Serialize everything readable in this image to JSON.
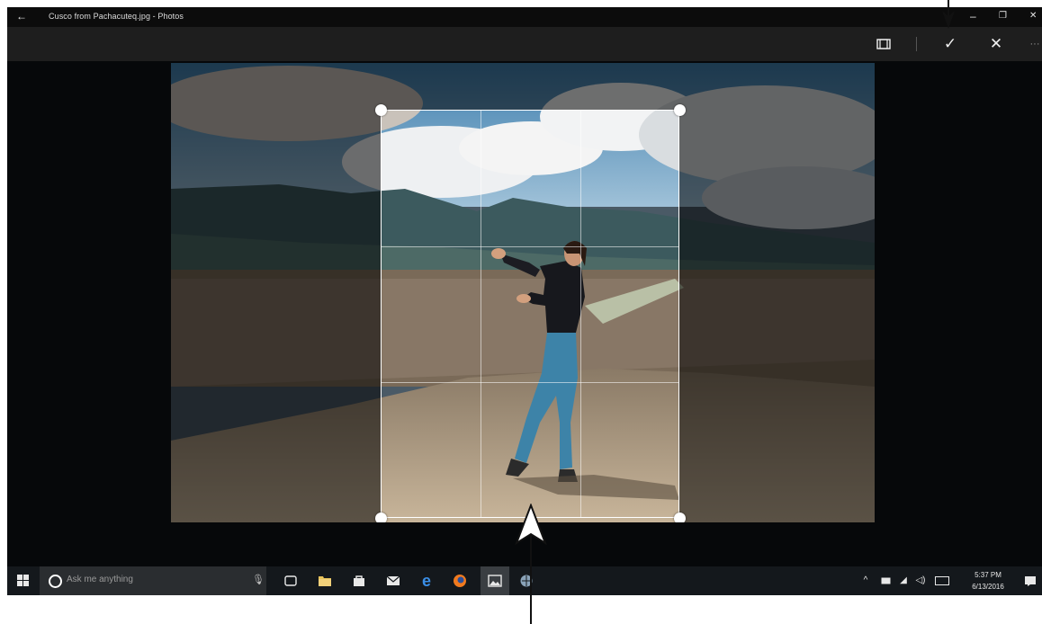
{
  "window": {
    "title": "Cusco from Pachacuteq.jpg - Photos",
    "back_icon": "back-arrow-icon",
    "minimize_glyph": "–",
    "maximize_glyph": "❐",
    "close_glyph": "✕"
  },
  "commandbar": {
    "aspect_ratio_icon": "aspect-ratio-icon",
    "done_glyph": "✓",
    "cancel_glyph": "✕",
    "more_glyph": "···"
  },
  "crop": {
    "handles": [
      "top-left",
      "top-right",
      "bottom-left",
      "bottom-right"
    ],
    "frame_color": "#ffffff"
  },
  "taskbar": {
    "search_placeholder": "Ask me anything",
    "icons": [
      "windows-start-icon",
      "cortana-icon",
      "microphone-icon",
      "task-view-icon",
      "file-explorer-icon",
      "store-icon",
      "mail-icon",
      "edge-icon",
      "firefox-icon",
      "photos-icon",
      "network-app-icon"
    ],
    "clock_time": "5:37 PM",
    "clock_date": "6/13/2016"
  },
  "colors": {
    "window_bg": "#06080a",
    "commandbar_bg": "#1e1e1e",
    "taskbar_bg": "#14181c",
    "edge_blue": "#3a8ee6",
    "firefox_orange": "#f07a1e"
  }
}
